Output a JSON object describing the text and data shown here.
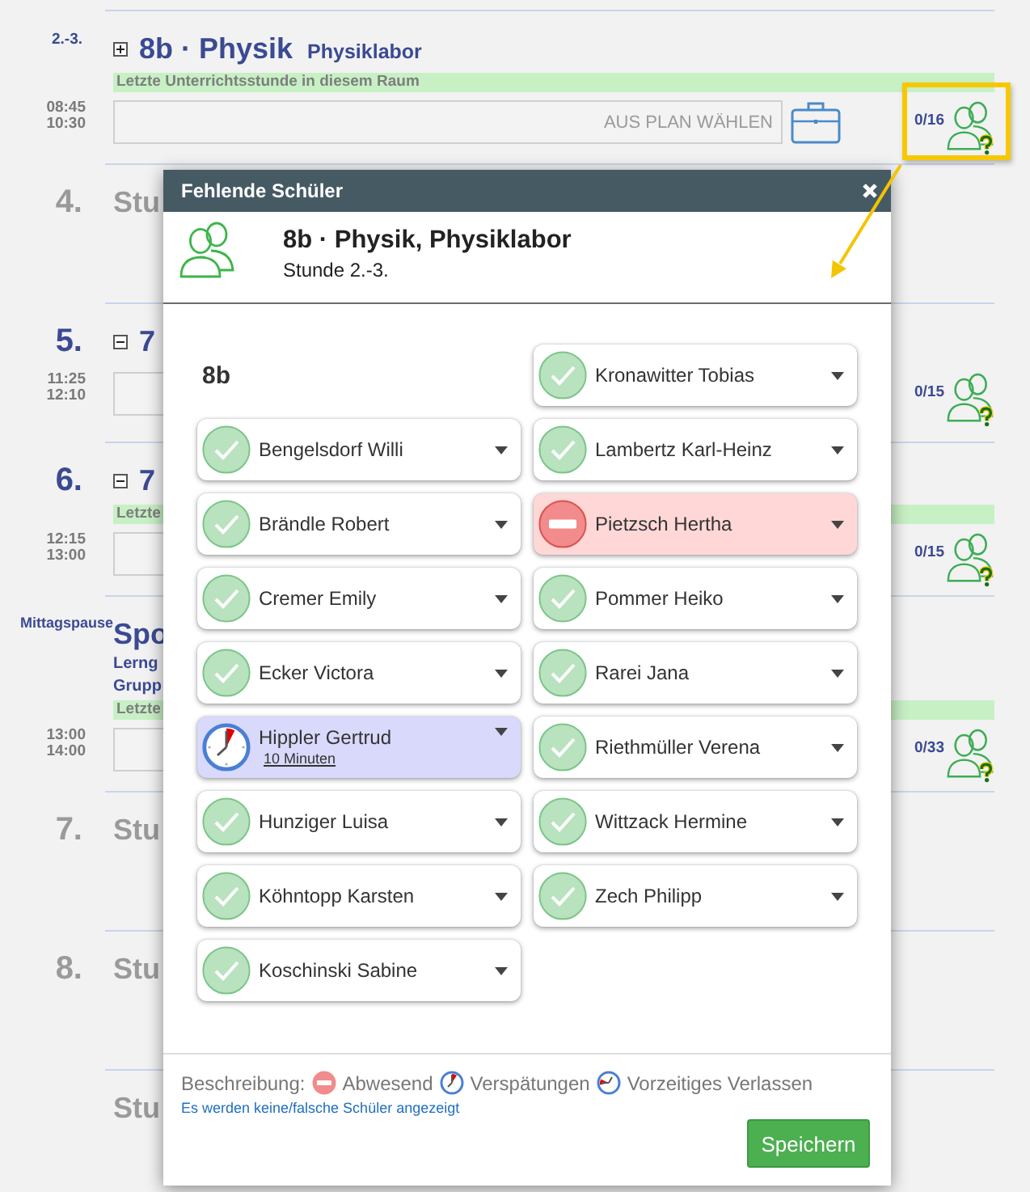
{
  "schedule": [
    {
      "kind": "double",
      "period": "2.-3.",
      "expanded": false,
      "title": "8b · Physik",
      "room": "Physiklabor",
      "notice": "Letzte Unterrichtsstunde in diesem Raum",
      "times": [
        "08:45",
        "10:30"
      ],
      "placeholder": "AUS PLAN WÄHLEN",
      "plan_button": true,
      "count": "0/16"
    },
    {
      "kind": "free",
      "period": "4.",
      "title": "Stu"
    },
    {
      "kind": "lesson",
      "period": "5.",
      "expanded": true,
      "title": "7",
      "times": [
        "11:25",
        "12:10"
      ],
      "count": "0/15"
    },
    {
      "kind": "lesson",
      "period": "6.",
      "expanded": true,
      "title": "7",
      "notice": "Letzte",
      "times": [
        "12:15",
        "13:00"
      ],
      "count": "0/15"
    },
    {
      "kind": "break",
      "side_label": "Mittagspause",
      "title": "Spo",
      "lines": [
        "Lerng",
        "Grupp"
      ],
      "notice": "Letzte",
      "times": [
        "13:00",
        "14:00"
      ],
      "count": "0/33"
    },
    {
      "kind": "free",
      "period": "7.",
      "title": "Stu"
    },
    {
      "kind": "free",
      "period": "8.",
      "title": "Stu"
    },
    {
      "kind": "free",
      "title": "Stu"
    }
  ],
  "annotation": {
    "highlight_frame": true,
    "arrow": true
  },
  "dialog": {
    "title": "Fehlende Schüler",
    "heading": "8b · Physik, Physiklabor",
    "subheading": "Stunde 2.-3.",
    "class_label": "8b",
    "students": [
      {
        "name": "Bengelsdorf Willi",
        "kind": "present"
      },
      {
        "name": "Brändle Robert",
        "kind": "present"
      },
      {
        "name": "Cremer Emily",
        "kind": "present"
      },
      {
        "name": "Ecker Victora",
        "kind": "present"
      },
      {
        "name": "Hippler Gertrud",
        "kind": "late",
        "note": "10 Minuten"
      },
      {
        "name": "Hunziger Luisa",
        "kind": "present"
      },
      {
        "name": "Köhntopp Karsten",
        "kind": "present"
      },
      {
        "name": "Koschinski Sabine",
        "kind": "present"
      },
      {
        "name": "Kronawitter Tobias",
        "kind": "present"
      },
      {
        "name": "Lambertz Karl-Heinz",
        "kind": "present"
      },
      {
        "name": "Pietzsch Hertha",
        "kind": "absent"
      },
      {
        "name": "Pommer Heiko",
        "kind": "present"
      },
      {
        "name": "Rarei Jana",
        "kind": "present"
      },
      {
        "name": "Riethmüller Verena",
        "kind": "present"
      },
      {
        "name": "Wittzack Hermine",
        "kind": "present"
      },
      {
        "name": "Zech Philipp",
        "kind": "present"
      }
    ],
    "legend_label": "Beschreibung:",
    "legend": [
      {
        "kind": "absent",
        "label": "Abwesend"
      },
      {
        "kind": "late",
        "label": "Verspätungen"
      },
      {
        "kind": "early_leave",
        "label": "Vorzeitiges Verlassen"
      }
    ],
    "link": "Es werden keine/falsche Schüler angezeigt",
    "save": "Speichern"
  }
}
